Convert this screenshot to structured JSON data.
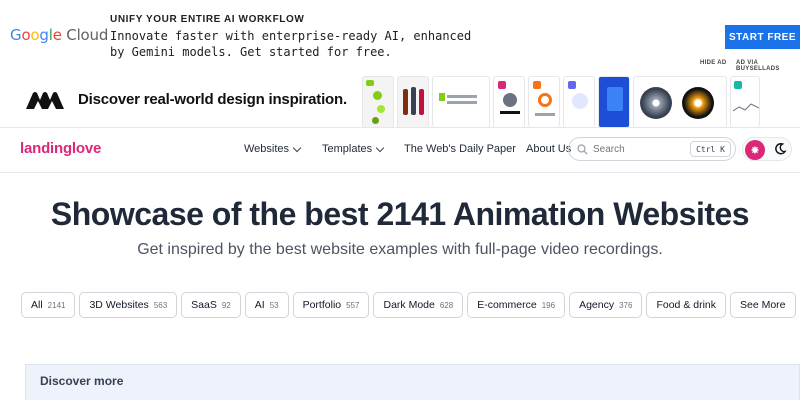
{
  "google_ad": {
    "logo": {
      "g": "G",
      "o1": "o",
      "o2": "o",
      "g2": "g",
      "l": "l",
      "e": "e",
      "cloud": " Cloud"
    },
    "headline": "UNIFY YOUR ENTIRE AI WORKFLOW",
    "body": "Innovate faster with enterprise-ready AI, enhanced by Gemini models. Get started for free.",
    "cta": "START FREE",
    "hide_ad": "HIDE AD",
    "ad_via": "AD VIA BUYSELLADS"
  },
  "design_ad": {
    "text": "Discover real-world design inspiration."
  },
  "nav": {
    "brand": "landinglove",
    "items": [
      {
        "label": "Websites"
      },
      {
        "label": "Templates"
      },
      {
        "label": "The Web's Daily Paper"
      },
      {
        "label": "About Us"
      }
    ],
    "search_placeholder": "Search",
    "search_shortcut": "Ctrl K"
  },
  "hero": {
    "title": "Showcase of the best 2141 Animation Websites",
    "subtitle": "Get inspired by the best website examples with full-page video recordings."
  },
  "filters": [
    {
      "label": "All",
      "count": "2141"
    },
    {
      "label": "3D Websites",
      "count": "563"
    },
    {
      "label": "SaaS",
      "count": "92"
    },
    {
      "label": "AI",
      "count": "53"
    },
    {
      "label": "Portfolio",
      "count": "557"
    },
    {
      "label": "Dark Mode",
      "count": "628"
    },
    {
      "label": "E-commerce",
      "count": "196"
    },
    {
      "label": "Agency",
      "count": "376"
    },
    {
      "label": "Food & drink",
      "count": ""
    },
    {
      "label": "See More",
      "count": ""
    }
  ],
  "discover": {
    "label": "Discover more"
  },
  "colors": {
    "brand": "#db2777",
    "cta": "#1a73e8"
  }
}
